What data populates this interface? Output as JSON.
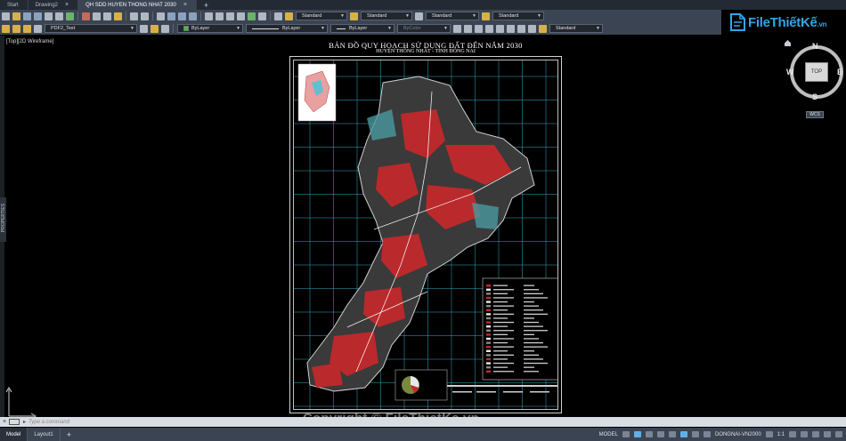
{
  "tabs": [
    {
      "label": "Start",
      "active": false,
      "closable": false
    },
    {
      "label": "Drawing2",
      "active": false,
      "closable": true
    },
    {
      "label": "QH SDD HUYEN THONG NHAT 2030",
      "active": true,
      "closable": true
    }
  ],
  "tab_close_glyph": "×",
  "tab_new_glyph": "+",
  "toolbar1": {
    "combos": [
      {
        "label": "Standard"
      },
      {
        "label": "Standard"
      },
      {
        "label": "Standard"
      },
      {
        "label": "Standard"
      }
    ]
  },
  "toolbar2": {
    "layer_combo": "PDF2_Text",
    "color_combo": "ByLayer",
    "linetype_combo": "ByLayer",
    "lineweight_combo": "ByLayer",
    "plotstyle_combo": "ByColor",
    "textstyle_combo": "Standard"
  },
  "logo": {
    "text_main": "FileThiếtKế",
    "text_ext": ".vn"
  },
  "viewport_label": "[Top][2D Wireframe]",
  "properties_label": "PROPERTIES",
  "map": {
    "title": "BẢN ĐỒ QUY HOẠCH SỬ DỤNG ĐẤT ĐẾN NĂM 2030",
    "subtitle": "HUYỆN THỐNG NHẤT - TỈNH ĐỒNG NAI"
  },
  "viewcube": {
    "north": "N",
    "south": "S",
    "east": "E",
    "west": "W",
    "face": "TOP",
    "wcs": "WCS"
  },
  "command_line": {
    "close_glyph": "×",
    "prompt": "▸",
    "placeholder": "Type a command"
  },
  "watermark": "Copyright © FileThietKe.vn",
  "layout_tabs": [
    {
      "label": "Model",
      "active": true
    },
    {
      "label": "Layout1",
      "active": false
    }
  ],
  "layout_add_glyph": "+",
  "status": {
    "model": "MODEL",
    "coordinate_system": "DONGNAI-VN2000",
    "scale": "1:1"
  },
  "colors": {
    "tab_bg": "#232a34",
    "toolbar_bg": "#3b4453",
    "canvas_bg": "#000000",
    "grid_line": "#45c8e6",
    "map_red": "#c8282a",
    "logo_blue": "#32a6e6"
  }
}
